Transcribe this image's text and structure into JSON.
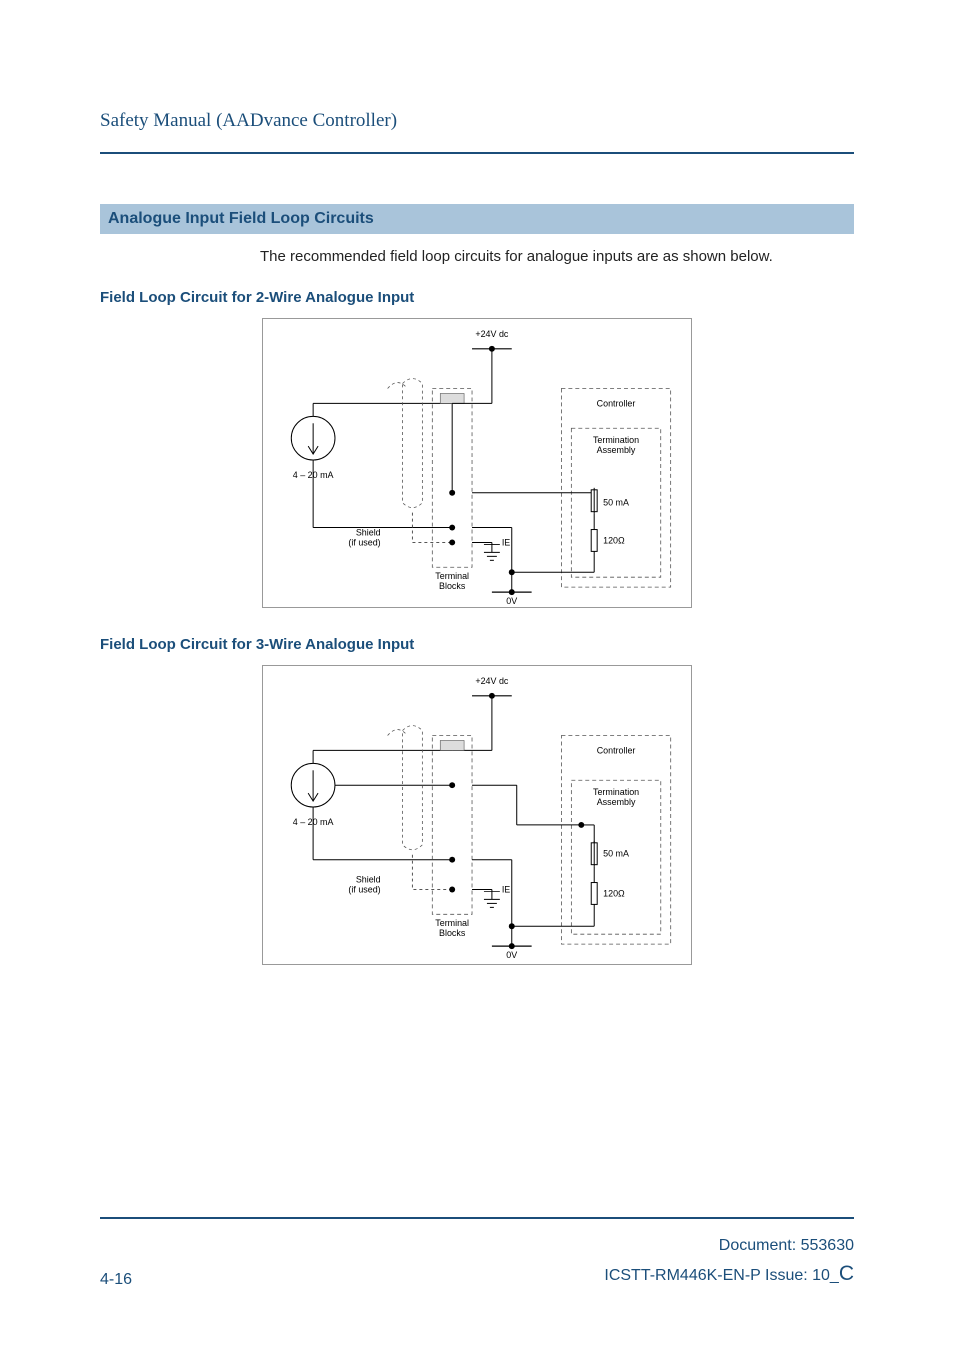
{
  "header": {
    "title": "Safety Manual (AADvance Controller)"
  },
  "section": {
    "heading": "Analogue Input Field Loop Circuits",
    "intro": "The recommended field loop circuits for analogue inputs are as shown below."
  },
  "sub1": {
    "heading": "Field Loop Circuit for 2-Wire Analogue Input"
  },
  "sub2": {
    "heading": "Field Loop Circuit for 3-Wire Analogue Input"
  },
  "diagram_labels": {
    "top_rail": "+24V dc",
    "bottom_rail": "0V",
    "sensor_current": "4 – 20 mA",
    "shield_label_1": "Shield",
    "shield_label_2": "(if used)",
    "terminal_label_1": "Terminal",
    "terminal_label_2": "Blocks",
    "ie_label": "IE",
    "controller": "Controller",
    "termination_l1": "Termination",
    "termination_l2": "Assembly",
    "fuse_current": "50 mA",
    "resistor_value": "120Ω"
  },
  "footer": {
    "page_num": "4-16",
    "doc_label": "Document: 553630",
    "issue_prefix": "ICSTT-RM446K-EN-P Issue: 10_",
    "issue_suffix": "C"
  }
}
